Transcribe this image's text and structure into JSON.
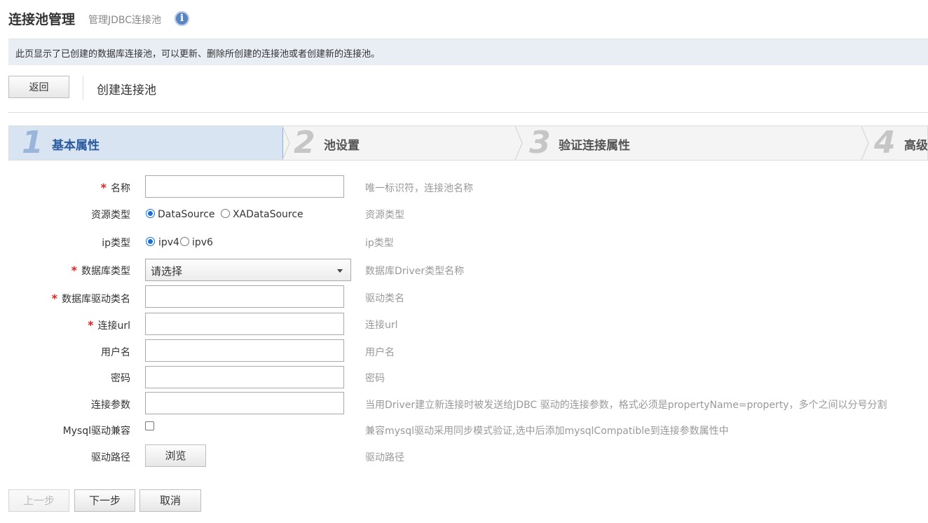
{
  "header": {
    "title": "连接池管理",
    "subtitle": "管理JDBC连接池",
    "info_icon": "i"
  },
  "notice": "此页显示了已创建的数据库连接池，可以更新、删除所创建的连接池或者创建新的连接池。",
  "toolbar": {
    "back_label": "返回",
    "page_title": "创建连接池"
  },
  "wizard": {
    "steps": [
      {
        "num": "1",
        "label": "基本属性",
        "active": true
      },
      {
        "num": "2",
        "label": "池设置",
        "active": false
      },
      {
        "num": "3",
        "label": "验证连接属性",
        "active": false
      },
      {
        "num": "4",
        "label": "高级",
        "active": false
      }
    ]
  },
  "form": {
    "name": {
      "label": "名称",
      "required": true,
      "value": "",
      "hint": "唯一标识符，连接池名称"
    },
    "resource_type": {
      "label": "资源类型",
      "options": [
        "DataSource",
        "XADataSource"
      ],
      "selected": "DataSource",
      "hint": "资源类型"
    },
    "ip_type": {
      "label": "ip类型",
      "options": [
        "ipv4",
        "ipv6"
      ],
      "selected": "ipv4",
      "hint": "ip类型"
    },
    "db_type": {
      "label": "数据库类型",
      "required": true,
      "value": "请选择",
      "hint": "数据库Driver类型名称"
    },
    "driver_class": {
      "label": "数据库驱动类名",
      "required": true,
      "value": "",
      "hint": "驱动类名"
    },
    "url": {
      "label": "连接url",
      "required": true,
      "value": "",
      "hint": "连接url"
    },
    "username": {
      "label": "用户名",
      "value": "",
      "hint": "用户名"
    },
    "password": {
      "label": "密码",
      "value": "",
      "hint": "密码"
    },
    "conn_params": {
      "label": "连接参数",
      "value": "",
      "hint": "当用Driver建立新连接时被发送给JDBC 驱动的连接参数，格式必须是propertyName=property，多个之间以分号分割"
    },
    "mysql_compat": {
      "label": "Mysql驱动兼容",
      "checked": false,
      "hint": "兼容mysql驱动采用同步模式验证,选中后添加mysqlCompatible到连接参数属性中"
    },
    "driver_path": {
      "label": "驱动路径",
      "button": "浏览",
      "hint": "驱动路径"
    }
  },
  "footer": {
    "prev_label": "上一步",
    "next_label": "下一步",
    "cancel_label": "取消"
  },
  "required_mark": "*"
}
